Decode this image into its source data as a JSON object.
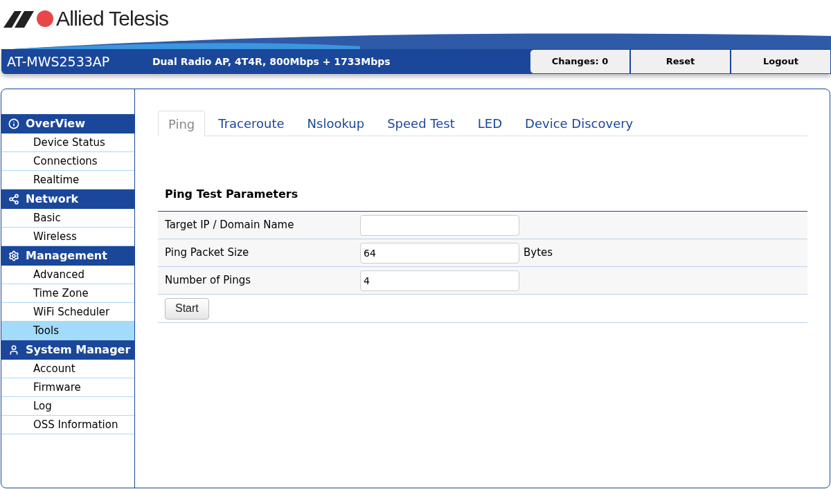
{
  "logo": {
    "text": "Allied Telesis"
  },
  "header": {
    "model": "AT-MWS2533AP",
    "description": "Dual Radio AP, 4T4R, 800Mbps + 1733Mbps",
    "buttons": [
      "Changes: 0",
      "Reset",
      "Logout"
    ]
  },
  "sidebar": {
    "sections": [
      {
        "kind": "info",
        "title": "OverView",
        "items": [
          {
            "label": "Device Status",
            "selected": false
          },
          {
            "label": "Connections",
            "selected": false
          },
          {
            "label": "Realtime",
            "selected": false
          }
        ]
      },
      {
        "kind": "share",
        "title": "Network",
        "items": [
          {
            "label": "Basic",
            "selected": false
          },
          {
            "label": "Wireless",
            "selected": false
          }
        ]
      },
      {
        "kind": "gear",
        "title": "Management",
        "items": [
          {
            "label": "Advanced",
            "selected": false
          },
          {
            "label": "Time Zone",
            "selected": false
          },
          {
            "label": "WiFi Scheduler",
            "selected": false
          },
          {
            "label": "Tools",
            "selected": true
          }
        ]
      },
      {
        "kind": "user",
        "title": "System Manager",
        "items": [
          {
            "label": "Account",
            "selected": false
          },
          {
            "label": "Firmware",
            "selected": false
          },
          {
            "label": "Log",
            "selected": false
          },
          {
            "label": "OSS Information",
            "selected": false
          }
        ]
      }
    ]
  },
  "tabs": [
    {
      "label": "Ping",
      "selected": true
    },
    {
      "label": "Traceroute",
      "selected": false
    },
    {
      "label": "Nslookup",
      "selected": false
    },
    {
      "label": "Speed Test",
      "selected": false
    },
    {
      "label": "LED",
      "selected": false
    },
    {
      "label": "Device Discovery",
      "selected": false
    }
  ],
  "form": {
    "title": "Ping Test Parameters",
    "rows": [
      {
        "label": "Target IP / Domain Name",
        "value": ""
      },
      {
        "label": "Ping Packet Size",
        "value": "64",
        "unit": "Bytes"
      },
      {
        "label": "Number of Pings",
        "value": "4"
      }
    ],
    "button": "Start"
  }
}
